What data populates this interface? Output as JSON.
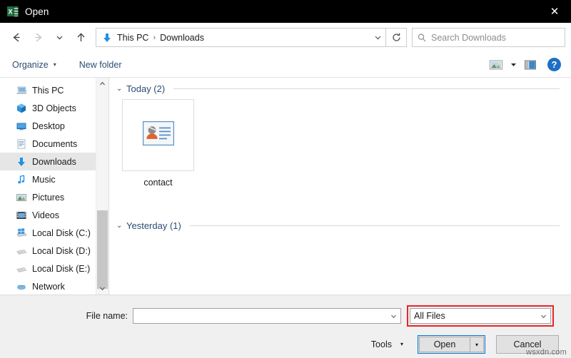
{
  "window": {
    "title": "Open",
    "app_icon": "excel-icon",
    "close_label": "✕",
    "titlebar_color": "#000000"
  },
  "navigation": {
    "back_label": "←",
    "forward_label": "→",
    "recent_label": "⌄",
    "up_label": "↑",
    "address_icon": "downloads-arrow-icon",
    "breadcrumbs": [
      "This PC",
      "Downloads"
    ],
    "separator": "›",
    "dropdown_label": "⌄",
    "refresh_label": "↻"
  },
  "search": {
    "icon": "search-icon",
    "placeholder": "Search Downloads"
  },
  "toolbar": {
    "organize_label": "Organize",
    "organize_caret": "▾",
    "new_folder_label": "New folder",
    "view_icon": "view-thumbnails-icon",
    "view_caret": "▾",
    "preview_pane_icon": "preview-pane-icon",
    "help_label": "?"
  },
  "sidebar": {
    "items": [
      {
        "label": "This PC",
        "icon": "computer-icon",
        "selected": false
      },
      {
        "label": "3D Objects",
        "icon": "3d-objects-icon",
        "selected": false
      },
      {
        "label": "Desktop",
        "icon": "desktop-icon",
        "selected": false
      },
      {
        "label": "Documents",
        "icon": "documents-icon",
        "selected": false
      },
      {
        "label": "Downloads",
        "icon": "downloads-icon",
        "selected": true
      },
      {
        "label": "Music",
        "icon": "music-icon",
        "selected": false
      },
      {
        "label": "Pictures",
        "icon": "pictures-icon",
        "selected": false
      },
      {
        "label": "Videos",
        "icon": "videos-icon",
        "selected": false
      },
      {
        "label": "Local Disk (C:)",
        "icon": "system-disk-icon",
        "selected": false
      },
      {
        "label": "Local Disk (D:)",
        "icon": "disk-icon",
        "selected": false
      },
      {
        "label": "Local Disk (E:)",
        "icon": "disk-icon",
        "selected": false
      },
      {
        "label": "Network",
        "icon": "network-icon",
        "selected": false
      }
    ],
    "scroll_up": "⌃",
    "scroll_down": "⌄"
  },
  "file_pane": {
    "groups": [
      {
        "label": "Today (2)",
        "chevron": "⌄",
        "files": [
          {
            "name": "contact",
            "icon": "contact-card-icon"
          }
        ]
      },
      {
        "label": "Yesterday (1)",
        "chevron": "⌄",
        "files": []
      }
    ]
  },
  "footer": {
    "file_name_label": "File name:",
    "file_name_value": "",
    "file_name_placeholder": "",
    "file_name_caret": "⌄",
    "filter_value": "All Files",
    "filter_caret": "⌄",
    "filter_highlight_color": "#e8262a",
    "tools_label": "Tools",
    "tools_caret": "▾",
    "open_label": "Open",
    "open_caret": "▾",
    "cancel_label": "Cancel",
    "focus_color": "#0078d7"
  },
  "watermark": {
    "text": "wsxdn.com"
  }
}
